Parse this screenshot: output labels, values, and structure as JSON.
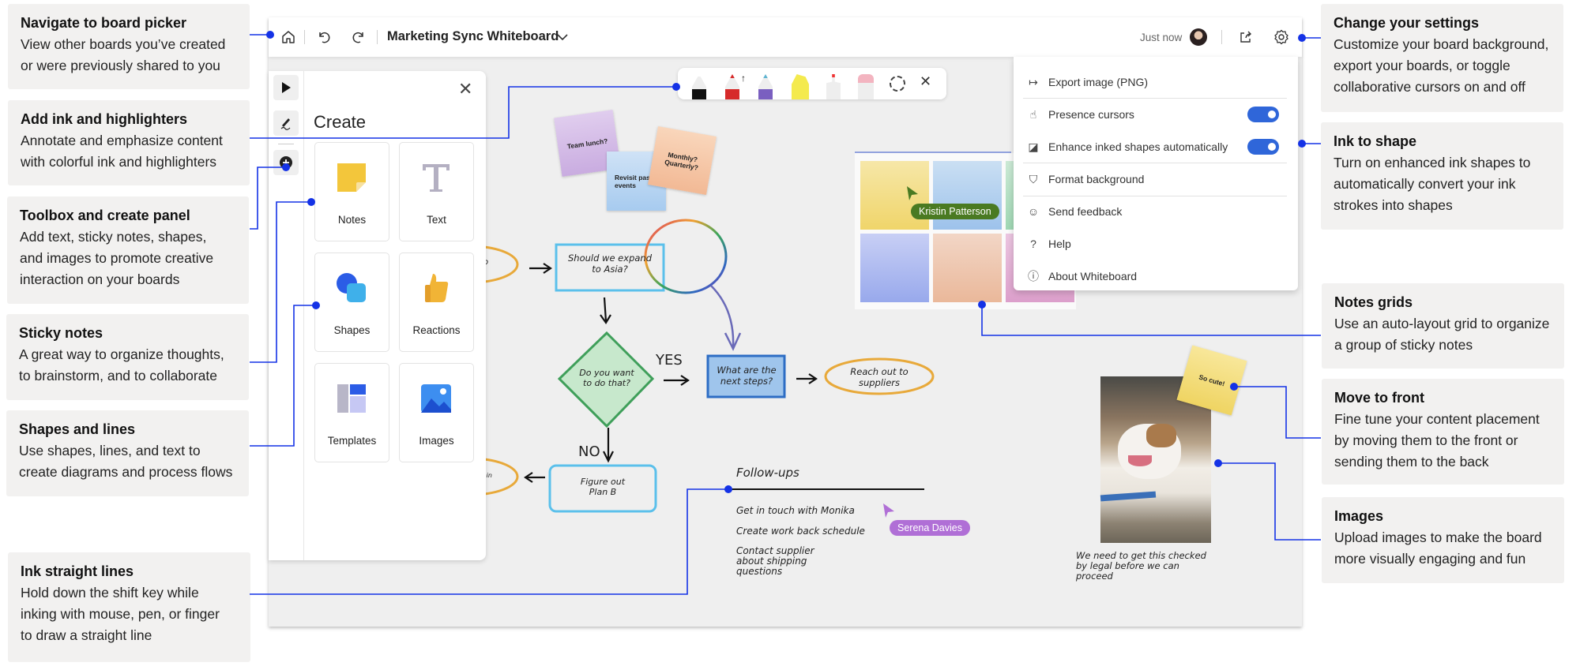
{
  "callouts_left": [
    {
      "title": "Navigate to board picker",
      "desc": [
        "View other boards you’ve created",
        "or were previously shared to you"
      ]
    },
    {
      "title": "Add ink and highlighters",
      "desc": [
        "Annotate and emphasize content",
        "with colorful ink and highlighters"
      ]
    },
    {
      "title": "Toolbox and create panel",
      "desc": [
        "Add text, sticky notes, shapes,",
        "and images to promote creative",
        "interaction on your boards"
      ]
    },
    {
      "title": "Sticky notes",
      "desc": [
        "A great way to organize thoughts,",
        "to brainstorm, and to collaborate"
      ]
    },
    {
      "title": "Shapes and lines",
      "desc": [
        "Use shapes, lines, and text to",
        "create diagrams and process flows"
      ]
    },
    {
      "title": "Ink straight lines",
      "desc": [
        "Hold down the shift key while",
        "inking with mouse, pen, or finger",
        "to draw a straight line"
      ]
    }
  ],
  "callouts_right": [
    {
      "title": "Change your settings",
      "desc": [
        "Customize your board background,",
        "export your boards, or toggle",
        "collaborative cursors on and off"
      ]
    },
    {
      "title": "Ink to shape",
      "desc": [
        "Turn on enhanced ink shapes to",
        "automatically convert your ink",
        "strokes into shapes"
      ]
    },
    {
      "title": "Notes grids",
      "desc": [
        "Use an auto-layout grid to organize",
        "a group of sticky notes"
      ]
    },
    {
      "title": "Move to front",
      "desc": [
        "Fine tune your content placement",
        "by moving them to the front or",
        "sending them to the back"
      ]
    },
    {
      "title": "Images",
      "desc": [
        "Upload images to make the board",
        "more visually engaging and fun"
      ]
    }
  ],
  "topbar": {
    "title": "Marketing Sync Whiteboard",
    "status": "Just now",
    "icons": [
      "home-icon",
      "undo-icon",
      "redo-icon",
      "chevron-down-icon",
      "share-icon",
      "settings-icon"
    ]
  },
  "create_panel": {
    "title": "Create",
    "tiles": [
      {
        "label": "Notes",
        "icon": "sticky-note-icon"
      },
      {
        "label": "Text",
        "icon": "text-icon"
      },
      {
        "label": "Shapes",
        "icon": "shapes-icon"
      },
      {
        "label": "Reactions",
        "icon": "thumbs-up-icon"
      },
      {
        "label": "Templates",
        "icon": "templates-icon"
      },
      {
        "label": "Images",
        "icon": "image-icon"
      }
    ]
  },
  "ink_toolbar": {
    "tools": [
      "black-pen",
      "red-pen",
      "rainbow-pen",
      "yellow-highlighter",
      "laser-pointer",
      "eraser",
      "lasso-select",
      "close"
    ]
  },
  "settings_menu": {
    "items": [
      {
        "label": "Export image (PNG)",
        "icon": "export-icon"
      },
      {
        "label": "Presence cursors",
        "icon": "presence-cursor-icon",
        "toggle": true
      },
      {
        "label": "Enhance inked shapes automatically",
        "icon": "ink-shape-icon",
        "toggle": true
      },
      {
        "label": "Format background",
        "icon": "paint-bucket-icon"
      },
      {
        "label": "Send feedback",
        "icon": "feedback-icon"
      },
      {
        "label": "Help",
        "icon": "help-icon"
      },
      {
        "label": "About Whiteboard",
        "icon": "info-icon"
      }
    ],
    "accent": "#2f66d9"
  },
  "canvas": {
    "stickies": [
      "Team lunch?",
      "Revisit past events",
      "Monthly? Quarterly?",
      "So cute!"
    ],
    "flow": {
      "question": "Should we expand to Asia?",
      "decision": "Do you want to do that?",
      "yes_label": "YES",
      "no_label": "NO",
      "next_steps": "What are the next steps?",
      "reach_out": "Reach out to suppliers",
      "plan_b": "Figure out Plan B",
      "left_oval_top": "o",
      "left_oval_bottom": "d in"
    },
    "followups": {
      "title": "Follow-ups",
      "items": [
        "Get in touch with Monika",
        "Create work back schedule",
        "Contact supplier about shipping questions"
      ]
    },
    "image_caption": "We need to get this checked by legal before we can proceed",
    "presence": [
      {
        "name": "Kristin Patterson",
        "color": "#4a7a22"
      },
      {
        "name": "Serena Davies",
        "color": "#b06fd6"
      }
    ]
  },
  "callout_line_color": "#1432e6"
}
